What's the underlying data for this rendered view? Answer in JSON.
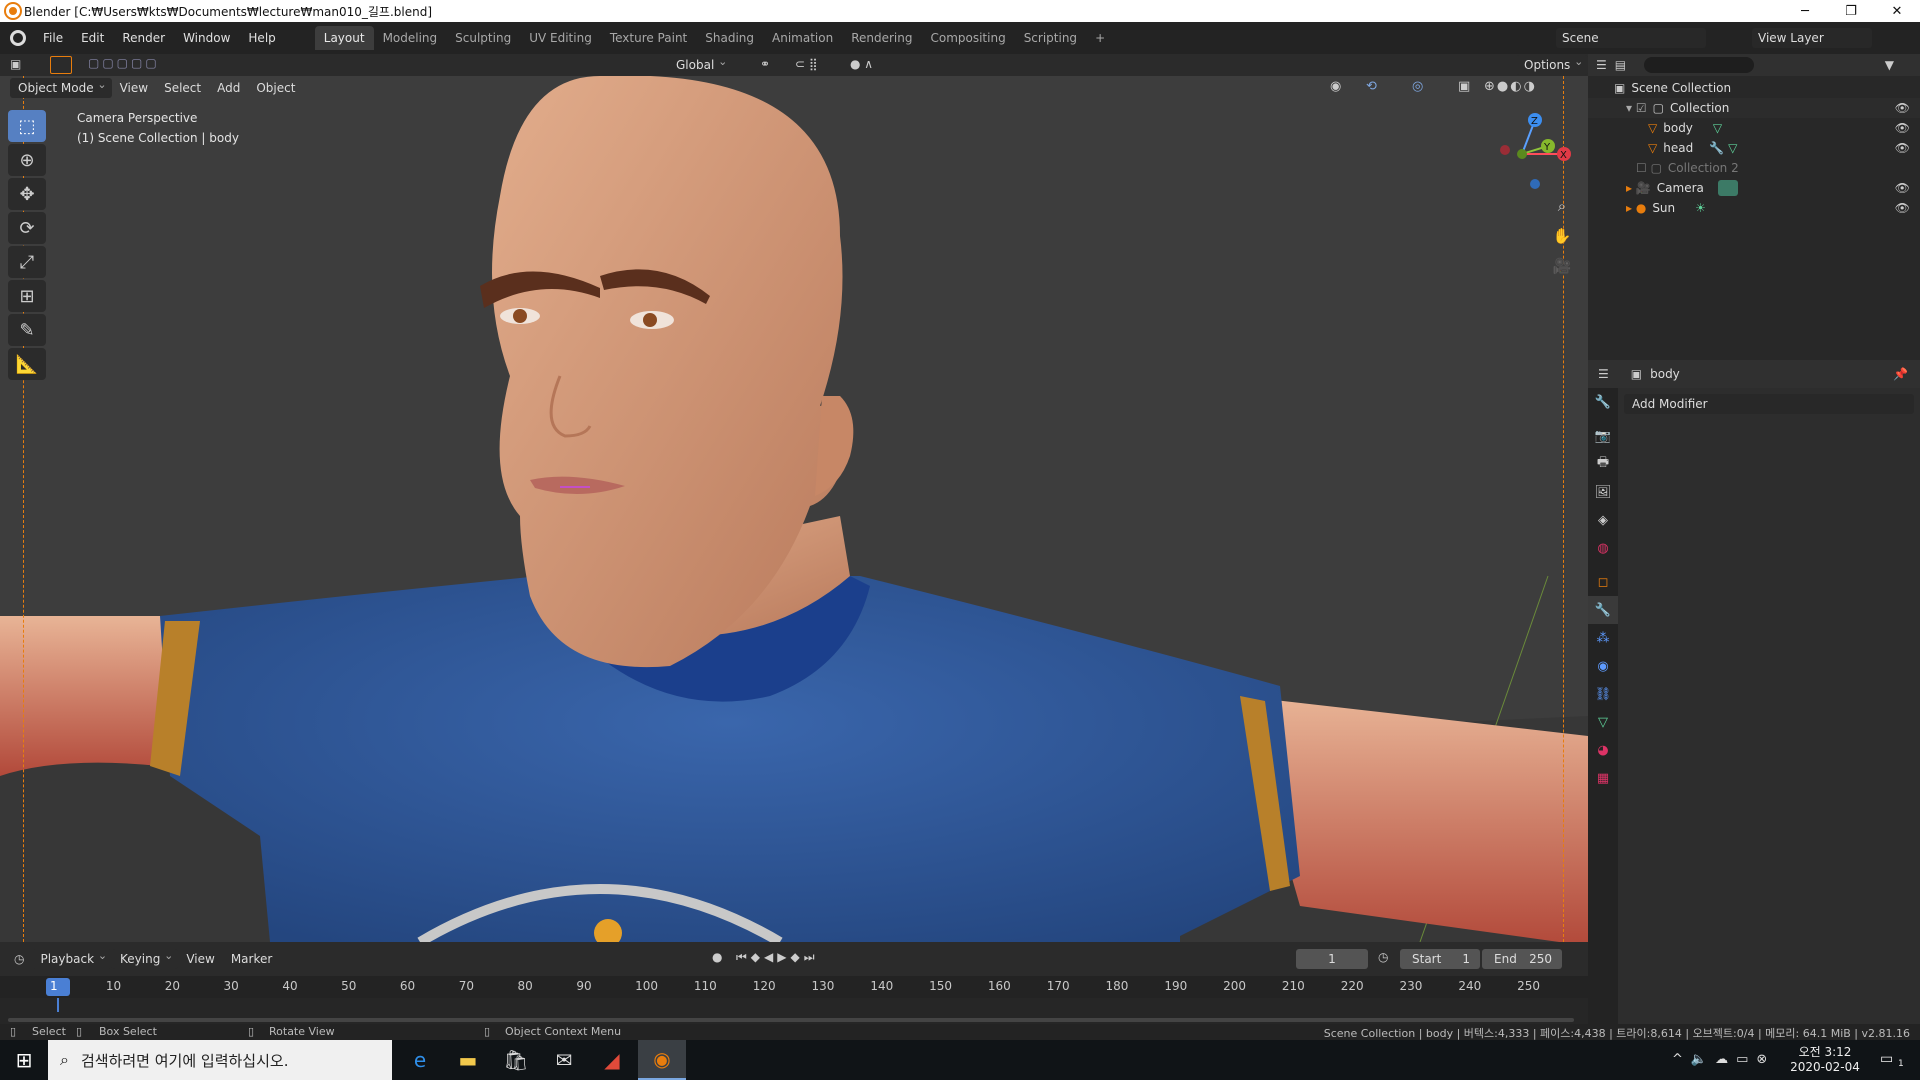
{
  "window": {
    "title": "Blender [C:₩Users₩kts₩Documents₩lecture₩man010_길프.blend]",
    "minimize": "─",
    "maximize": "❐",
    "close": "✕"
  },
  "menu": [
    "File",
    "Edit",
    "Render",
    "Window",
    "Help"
  ],
  "workspaces": [
    "Layout",
    "Modeling",
    "Sculpting",
    "UV Editing",
    "Texture Paint",
    "Shading",
    "Animation",
    "Rendering",
    "Compositing",
    "Scripting",
    "+"
  ],
  "scene": {
    "label": "Scene",
    "view_layer": "View Layer"
  },
  "toolbar2": {
    "orientation": "Global",
    "options": "Options"
  },
  "viewport": {
    "mode": "Object Mode",
    "menus": [
      "View",
      "Select",
      "Add",
      "Object"
    ],
    "overlay_line1": "Camera Perspective",
    "overlay_line2": "(1) Scene Collection | body",
    "gizmo": {
      "z": "Z",
      "y": "Y",
      "x": "X"
    }
  },
  "outliner": {
    "root": "Scene Collection",
    "items": [
      {
        "label": "Collection"
      },
      {
        "label": "body"
      },
      {
        "label": "head"
      },
      {
        "label": "Collection 2"
      },
      {
        "label": "Camera"
      },
      {
        "label": "Sun"
      }
    ]
  },
  "properties": {
    "object": "body",
    "add_modifier": "Add Modifier"
  },
  "timeline": {
    "menus": [
      "Playback",
      "Keying",
      "View",
      "Marker"
    ],
    "current_frame": "1",
    "start_label": "Start",
    "start": "1",
    "end_label": "End",
    "end": "250",
    "ticks": [
      "1",
      "10",
      "20",
      "30",
      "40",
      "50",
      "60",
      "70",
      "80",
      "90",
      "100",
      "110",
      "120",
      "130",
      "140",
      "150",
      "160",
      "170",
      "180",
      "190",
      "200",
      "210",
      "220",
      "230",
      "240",
      "250"
    ]
  },
  "status": {
    "select": "Select",
    "box_select": "Box Select",
    "rotate": "Rotate View",
    "context": "Object Context Menu",
    "info": "Scene Collection | body | 버텍스:4,333 | 페이스:4,438 | 트라이:8,614 | 오브젝트:0/4 | 메모리: 64.1 MiB | v2.81.16"
  },
  "taskbar": {
    "search_placeholder": "검색하려면 여기에 입력하십시오.",
    "time": "오전 3:12",
    "date": "2020-02-04",
    "notif": "1"
  },
  "colors": {
    "accent": "#5680c2",
    "orange": "#e87d0d",
    "shirt": "#2f5ea8",
    "skin": "#d79c7a"
  }
}
